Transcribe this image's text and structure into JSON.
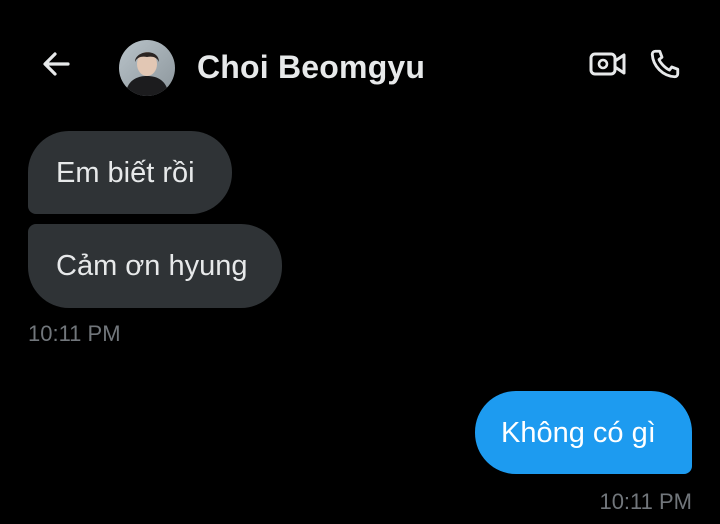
{
  "header": {
    "back_icon": "arrow-left-icon",
    "contact_name": "Choi Beomgyu",
    "avatar_icon": "user-avatar",
    "video_icon": "video-camera-icon",
    "call_icon": "phone-icon",
    "icon_color": "#e7e9ea"
  },
  "messages": [
    {
      "direction": "incoming",
      "text": "Em biết rồi"
    },
    {
      "direction": "incoming",
      "text": "Cảm ơn hyung"
    },
    {
      "direction": "outgoing",
      "text": "Không có gì"
    }
  ],
  "timestamps": {
    "incoming": "10:11 PM",
    "outgoing": "10:11 PM"
  },
  "colors": {
    "background": "#000000",
    "incoming_bubble": "#2f3336",
    "outgoing_bubble": "#1d9bf0",
    "timestamp": "#71767b"
  }
}
